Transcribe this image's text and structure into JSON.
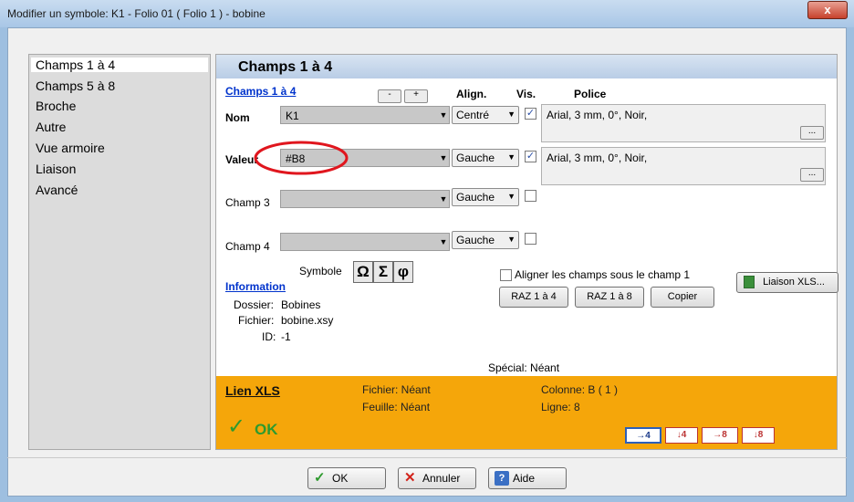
{
  "window": {
    "title": "Modifier un symbole: K1 - Folio 01 ( Folio 1 ) - bobine",
    "close_label": "x"
  },
  "sidebar": {
    "items": [
      "Champs 1 à 4",
      "Champs 5 à 8",
      "Broche",
      "Autre",
      "Vue armoire",
      "Liaison",
      "Avancé"
    ]
  },
  "panel": {
    "title": "Champs 1 à 4",
    "section_link": "Champs 1 à 4",
    "col_headers": {
      "align": "Align.",
      "vis": "Vis.",
      "police": "Police"
    },
    "minus": "-",
    "plus": "+",
    "rows": [
      {
        "label": "Nom",
        "value": "K1",
        "align": "Centré",
        "visible": true,
        "font": "Arial, 3 mm, 0°, Noir,",
        "btn": "..."
      },
      {
        "label": "Valeur",
        "value": "#B8",
        "align": "Gauche",
        "visible": true,
        "font": "Arial, 3 mm, 0°, Noir,",
        "btn": "..."
      },
      {
        "label": "Champ 3",
        "value": "",
        "align": "Gauche",
        "visible": false
      },
      {
        "label": "Champ 4",
        "value": "",
        "align": "Gauche",
        "visible": false
      }
    ],
    "symbole_label": "Symbole",
    "symbols": [
      "Ω",
      "Σ",
      "φ"
    ],
    "info_link": "Information",
    "info": [
      {
        "k": "Dossier:",
        "v": "Bobines"
      },
      {
        "k": "Fichier:",
        "v": "bobine.xsy"
      },
      {
        "k": "ID:",
        "v": "-1"
      }
    ],
    "align_checkbox": "Aligner les champs sous le champ 1",
    "raz1": "RAZ 1 à 4",
    "raz2": "RAZ 1 à 8",
    "copier": "Copier",
    "liaison_btn": "Liaison XLS...",
    "special": "Spécial: Néant"
  },
  "xls": {
    "title": "Lien XLS",
    "fichier": "Fichier: Néant",
    "feuille": "Feuille: Néant",
    "colonne": "Colonne: B ( 1 )",
    "ligne": "Ligne: 8",
    "ok": "OK",
    "icons": [
      "→4",
      "↓4",
      "→8",
      "↓8"
    ]
  },
  "footer": {
    "ok": "OK",
    "cancel": "Annuler",
    "help": "Aide"
  },
  "colors": {
    "accent": "#f5a60a",
    "header": "#b9cde6",
    "link": "#0033cc",
    "ok_green": "#2e9a2e",
    "annotation": "#e0161e"
  }
}
